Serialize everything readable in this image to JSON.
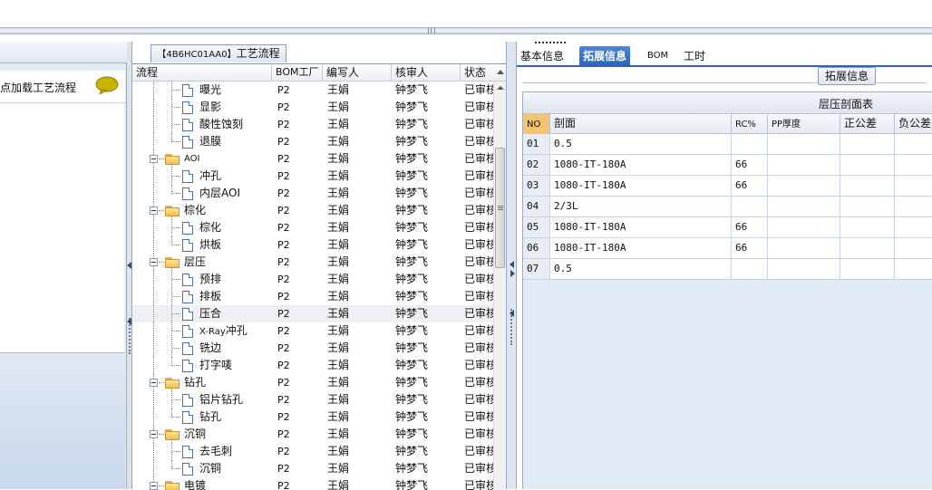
{
  "left_panel": {
    "load_label": "点加载工艺流程",
    "comment_icon": "speech-bubble-icon"
  },
  "process_panel": {
    "title_code": "【4B6HC01AA0】",
    "title_text": "工艺流程",
    "columns": [
      "流程",
      "BOM工厂",
      "编写人",
      "核审人",
      "状态"
    ],
    "rows": [
      {
        "name": "曝光",
        "kind": "leaf",
        "bom": "P2",
        "writer": "王娟",
        "reviewer": "钟梦飞",
        "status": "已审核"
      },
      {
        "name": "显影",
        "kind": "leaf",
        "bom": "P2",
        "writer": "王娟",
        "reviewer": "钟梦飞",
        "status": "已审核"
      },
      {
        "name": "酸性蚀刻",
        "kind": "leaf",
        "bom": "P2",
        "writer": "王娟",
        "reviewer": "钟梦飞",
        "status": "已审核"
      },
      {
        "name": "退膜",
        "kind": "leaf",
        "bom": "P2",
        "writer": "王娟",
        "reviewer": "钟梦飞",
        "status": "已审核"
      },
      {
        "name": "AOI",
        "kind": "group",
        "bom": "P2",
        "writer": "王娟",
        "reviewer": "钟梦飞",
        "status": "已审核"
      },
      {
        "name": "冲孔",
        "kind": "leaf",
        "bom": "P2",
        "writer": "王娟",
        "reviewer": "钟梦飞",
        "status": "已审核"
      },
      {
        "name": "内层AOI",
        "kind": "leaf",
        "bom": "P2",
        "writer": "王娟",
        "reviewer": "钟梦飞",
        "status": "已审核"
      },
      {
        "name": "棕化",
        "kind": "group",
        "bom": "P2",
        "writer": "王娟",
        "reviewer": "钟梦飞",
        "status": "已审核"
      },
      {
        "name": "棕化",
        "kind": "leaf",
        "bom": "P2",
        "writer": "王娟",
        "reviewer": "钟梦飞",
        "status": "已审核"
      },
      {
        "name": "烘板",
        "kind": "leaf",
        "bom": "P2",
        "writer": "王娟",
        "reviewer": "钟梦飞",
        "status": "已审核"
      },
      {
        "name": "层压",
        "kind": "group",
        "bom": "P2",
        "writer": "王娟",
        "reviewer": "钟梦飞",
        "status": "已审核"
      },
      {
        "name": "预排",
        "kind": "leaf",
        "bom": "P2",
        "writer": "王娟",
        "reviewer": "钟梦飞",
        "status": "已审核"
      },
      {
        "name": "排板",
        "kind": "leaf",
        "bom": "P2",
        "writer": "王娟",
        "reviewer": "钟梦飞",
        "status": "已审核"
      },
      {
        "name": "压合",
        "kind": "leaf",
        "bom": "P2",
        "writer": "王娟",
        "reviewer": "钟梦飞",
        "status": "已审核",
        "selected": true
      },
      {
        "name": "X-Ray冲孔",
        "kind": "leaf",
        "bom": "P2",
        "writer": "王娟",
        "reviewer": "钟梦飞",
        "status": "已审核"
      },
      {
        "name": "铣边",
        "kind": "leaf",
        "bom": "P2",
        "writer": "王娟",
        "reviewer": "钟梦飞",
        "status": "已审核"
      },
      {
        "name": "打字唛",
        "kind": "leaf",
        "bom": "P2",
        "writer": "王娟",
        "reviewer": "钟梦飞",
        "status": "已审核"
      },
      {
        "name": "钻孔",
        "kind": "group",
        "bom": "P2",
        "writer": "王娟",
        "reviewer": "钟梦飞",
        "status": "已审核"
      },
      {
        "name": "铝片钻孔",
        "kind": "leaf",
        "bom": "P2",
        "writer": "王娟",
        "reviewer": "钟梦飞",
        "status": "已审核"
      },
      {
        "name": "钻孔",
        "kind": "leaf",
        "bom": "P2",
        "writer": "王娟",
        "reviewer": "钟梦飞",
        "status": "已审核"
      },
      {
        "name": "沉铜",
        "kind": "group",
        "bom": "P2",
        "writer": "王娟",
        "reviewer": "钟梦飞",
        "status": "已审核"
      },
      {
        "name": "去毛刺",
        "kind": "leaf",
        "bom": "P2",
        "writer": "王娟",
        "reviewer": "钟梦飞",
        "status": "已审核"
      },
      {
        "name": "沉铜",
        "kind": "leaf",
        "bom": "P2",
        "writer": "王娟",
        "reviewer": "钟梦飞",
        "status": "已审核"
      },
      {
        "name": "电镀",
        "kind": "group",
        "bom": "P2",
        "writer": "王娟",
        "reviewer": "钟梦飞",
        "status": "已审核"
      }
    ]
  },
  "detail_panel": {
    "tabs": [
      {
        "label": "基本信息",
        "active": false
      },
      {
        "label": "拓展信息",
        "active": true
      },
      {
        "label": "BOM",
        "active": false
      },
      {
        "label": "工时",
        "active": false
      }
    ],
    "section_label": "拓展信息",
    "grid_title": "层压剖面表",
    "columns": [
      "NO",
      "剖面",
      "RC%",
      "PP厚度",
      "正公差",
      "负公差"
    ],
    "rows": [
      {
        "no": "01",
        "profile": "0.5",
        "rc": "",
        "pp": "",
        "plus": "",
        "minus": ""
      },
      {
        "no": "02",
        "profile": "1080-IT-180A",
        "rc": "66",
        "pp": "",
        "plus": "",
        "minus": ""
      },
      {
        "no": "03",
        "profile": "1080-IT-180A",
        "rc": "66",
        "pp": "",
        "plus": "",
        "minus": ""
      },
      {
        "no": "04",
        "profile": "2/3L",
        "rc": "",
        "pp": "",
        "plus": "",
        "minus": ""
      },
      {
        "no": "05",
        "profile": "1080-IT-180A",
        "rc": "66",
        "pp": "",
        "plus": "",
        "minus": ""
      },
      {
        "no": "06",
        "profile": "1080-IT-180A",
        "rc": "66",
        "pp": "",
        "plus": "",
        "minus": ""
      },
      {
        "no": "07",
        "profile": "0.5",
        "rc": "",
        "pp": "",
        "plus": "",
        "minus": ""
      }
    ]
  },
  "colors": {
    "active_tab": "#2b63b8",
    "no_header": "#f4c471",
    "folder": "#f0bf4e"
  }
}
